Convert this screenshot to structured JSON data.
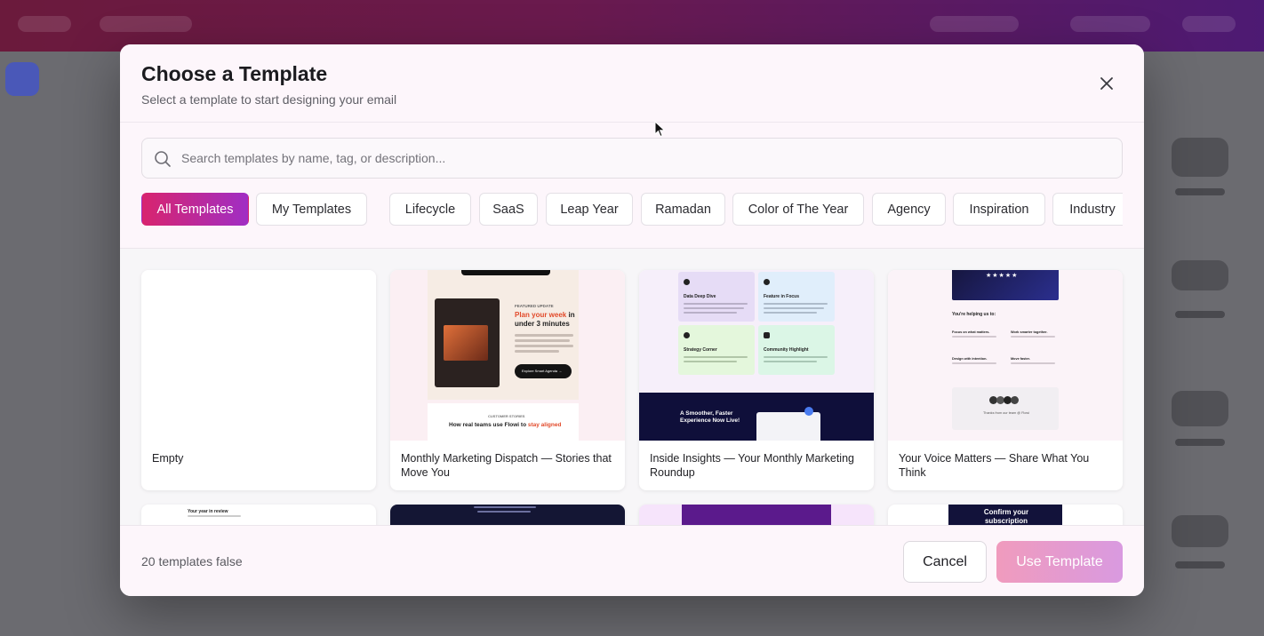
{
  "modal": {
    "title": "Choose a Template",
    "subtitle": "Select a template to start designing your email"
  },
  "search": {
    "placeholder": "Search templates by name, tag, or description..."
  },
  "tags": [
    {
      "label": "All Templates",
      "active": true
    },
    {
      "label": "My Templates",
      "active": false
    },
    {
      "label": "Lifecycle",
      "active": false
    },
    {
      "label": "SaaS",
      "active": false
    },
    {
      "label": "Leap Year",
      "active": false
    },
    {
      "label": "Ramadan",
      "active": false
    },
    {
      "label": "Color of The Year",
      "active": false
    },
    {
      "label": "Agency",
      "active": false
    },
    {
      "label": "Inspiration",
      "active": false
    },
    {
      "label": "Industry",
      "active": false
    }
  ],
  "templates": [
    {
      "name": "Empty"
    },
    {
      "name": "Monthly Marketing Dispatch — Stories that Move You"
    },
    {
      "name": "Inside Insights — Your Monthly Marketing Roundup"
    },
    {
      "name": "Your Voice Matters — Share What You Think"
    }
  ],
  "thumbs": {
    "dispatch": {
      "badge": "FEATURED UPDATE",
      "headline_accent": "Plan your week",
      "headline_rest": " in under 3 minutes",
      "cta": "Explore Smart Agenda →",
      "section_badge": "CUSTOMER STORIES",
      "section_title": "How real teams use Flowi to ",
      "section_title_accent": "stay aligned"
    },
    "insights": {
      "box1": "Data Deep Dive",
      "box2": "Feature in Focus",
      "box3": "Strategy Corner",
      "box4": "Community Highlight",
      "banner": "A Smoother, Faster Experience Now Live!"
    },
    "voice": {
      "stars": "★★★★★",
      "heading": "You're helping us to:",
      "items": [
        "Focus on what matters.",
        "Work smarter together.",
        "Design with intention.",
        "Move faster."
      ],
      "thanks": "Thanks from our team @ Flowi"
    },
    "row2": {
      "year_review": "Your year in review",
      "confirm": "Confirm your subscription"
    }
  },
  "footer": {
    "count": "20 templates false",
    "cancel": "Cancel",
    "use": "Use Template"
  },
  "colors": {
    "accent_start": "#d8246e",
    "accent_end": "#a02ec4",
    "use_button": "#f09bbd"
  }
}
